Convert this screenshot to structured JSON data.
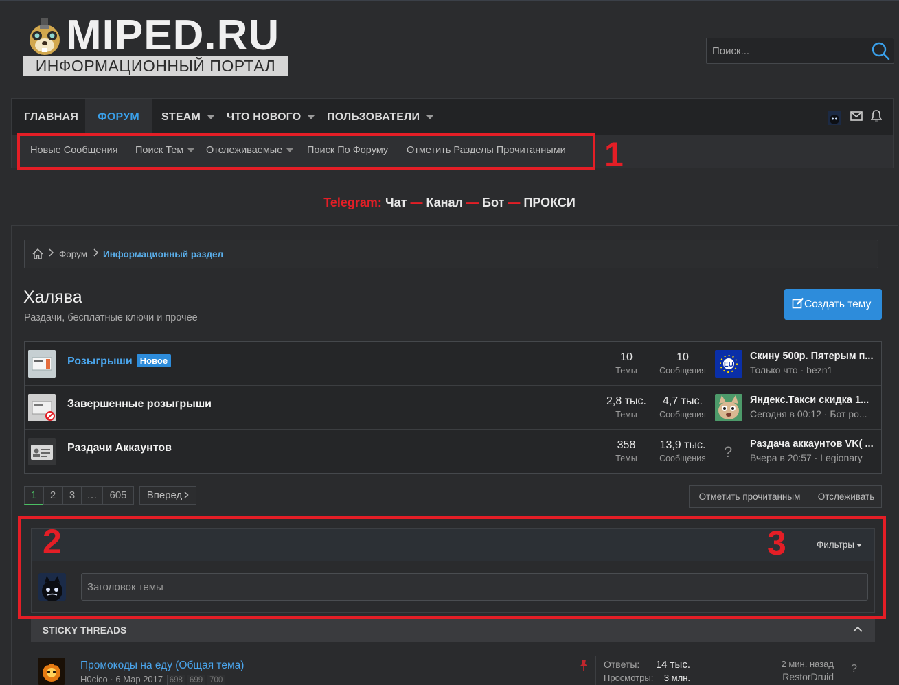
{
  "header": {
    "logo_text": "MIPED.RU",
    "logo_subtitle": "ИНФОРМАЦИОННЫЙ ПОРТАЛ",
    "search_placeholder": "Поиск..."
  },
  "nav": {
    "tabs": [
      {
        "label": "Главная",
        "active": false,
        "has_menu": false
      },
      {
        "label": "Форум",
        "active": true,
        "has_menu": false
      },
      {
        "label": "Steam",
        "active": false,
        "has_menu": true
      },
      {
        "label": "Что нового",
        "active": false,
        "has_menu": true
      },
      {
        "label": "Пользователи",
        "active": false,
        "has_menu": true
      }
    ],
    "icons": [
      "user-avatar-icon",
      "envelope-icon",
      "bell-icon"
    ]
  },
  "subnav": {
    "items": [
      {
        "label": "Новые Сообщения",
        "has_menu": false
      },
      {
        "label": "Поиск Тем",
        "has_menu": true
      },
      {
        "label": "Отслеживаемые",
        "has_menu": true
      },
      {
        "label": "Поиск По Форуму",
        "has_menu": false
      },
      {
        "label": "Отметить Разделы Прочитанными",
        "has_menu": false
      }
    ]
  },
  "annotations": {
    "box1_number": "1",
    "box2_number": "2",
    "box3_number": "3",
    "color": "#e41e26"
  },
  "telegram": {
    "prefix": "Telegram:",
    "links": [
      "Чат",
      "Канал",
      "Бот",
      "ПРОКСИ"
    ],
    "separator": "—"
  },
  "breadcrumb": {
    "items": [
      "Форум",
      "Информационный раздел"
    ]
  },
  "page": {
    "title": "Халява",
    "description": "Раздачи, бесплатные ключи и прочее",
    "create_button": "Создать тему"
  },
  "nodes": [
    {
      "title": "Розыгрыши",
      "badge": "Новое",
      "threads": "10",
      "threads_label": "Темы",
      "messages": "10",
      "messages_label": "Сообщения",
      "last_title": "Скину 500р. Пятерым п...",
      "last_meta": "Только что · bezn1",
      "last_avatar": "eu-flag"
    },
    {
      "title": "Завершенные розыгрыши",
      "badge": "",
      "threads": "2,8 тыс.",
      "threads_label": "Темы",
      "messages": "4,7 тыс.",
      "messages_label": "Сообщения",
      "last_title": "Яндекс.Такси скидка 1...",
      "last_meta": "Сегодня в 00:12 · Бот ро...",
      "last_avatar": "cat"
    },
    {
      "title": "Раздачи Аккаунтов",
      "badge": "",
      "threads": "358",
      "threads_label": "Темы",
      "messages": "13,9 тыс.",
      "messages_label": "Сообщения",
      "last_title": "Раздача аккаунтов VK( ...",
      "last_meta": "Вчера в 20:57 · Legionary_",
      "last_avatar": "question-mark"
    }
  ],
  "pagination": {
    "pages": [
      "1",
      "2",
      "3",
      "…",
      "605"
    ],
    "current": "1",
    "next_label": "Вперед"
  },
  "actions": {
    "mark_read": "Отметить прочитанным",
    "watch": "Отслеживать"
  },
  "quick_thread": {
    "filters_label": "Фильтры",
    "title_placeholder": "Заголовок темы"
  },
  "sticky": {
    "header": "STICKY THREADS",
    "threads": [
      {
        "title": "Промокоды на еду (Общая тема)",
        "author": "H0cico",
        "date": "6 Мар 2017",
        "pages": [
          "698",
          "699",
          "700"
        ],
        "replies_label": "Ответы:",
        "replies": "14 тыс.",
        "views_label": "Просмотры:",
        "views": "3 млн.",
        "last_time": "2 мин. назад",
        "last_user": "RestorDruid"
      }
    ]
  }
}
